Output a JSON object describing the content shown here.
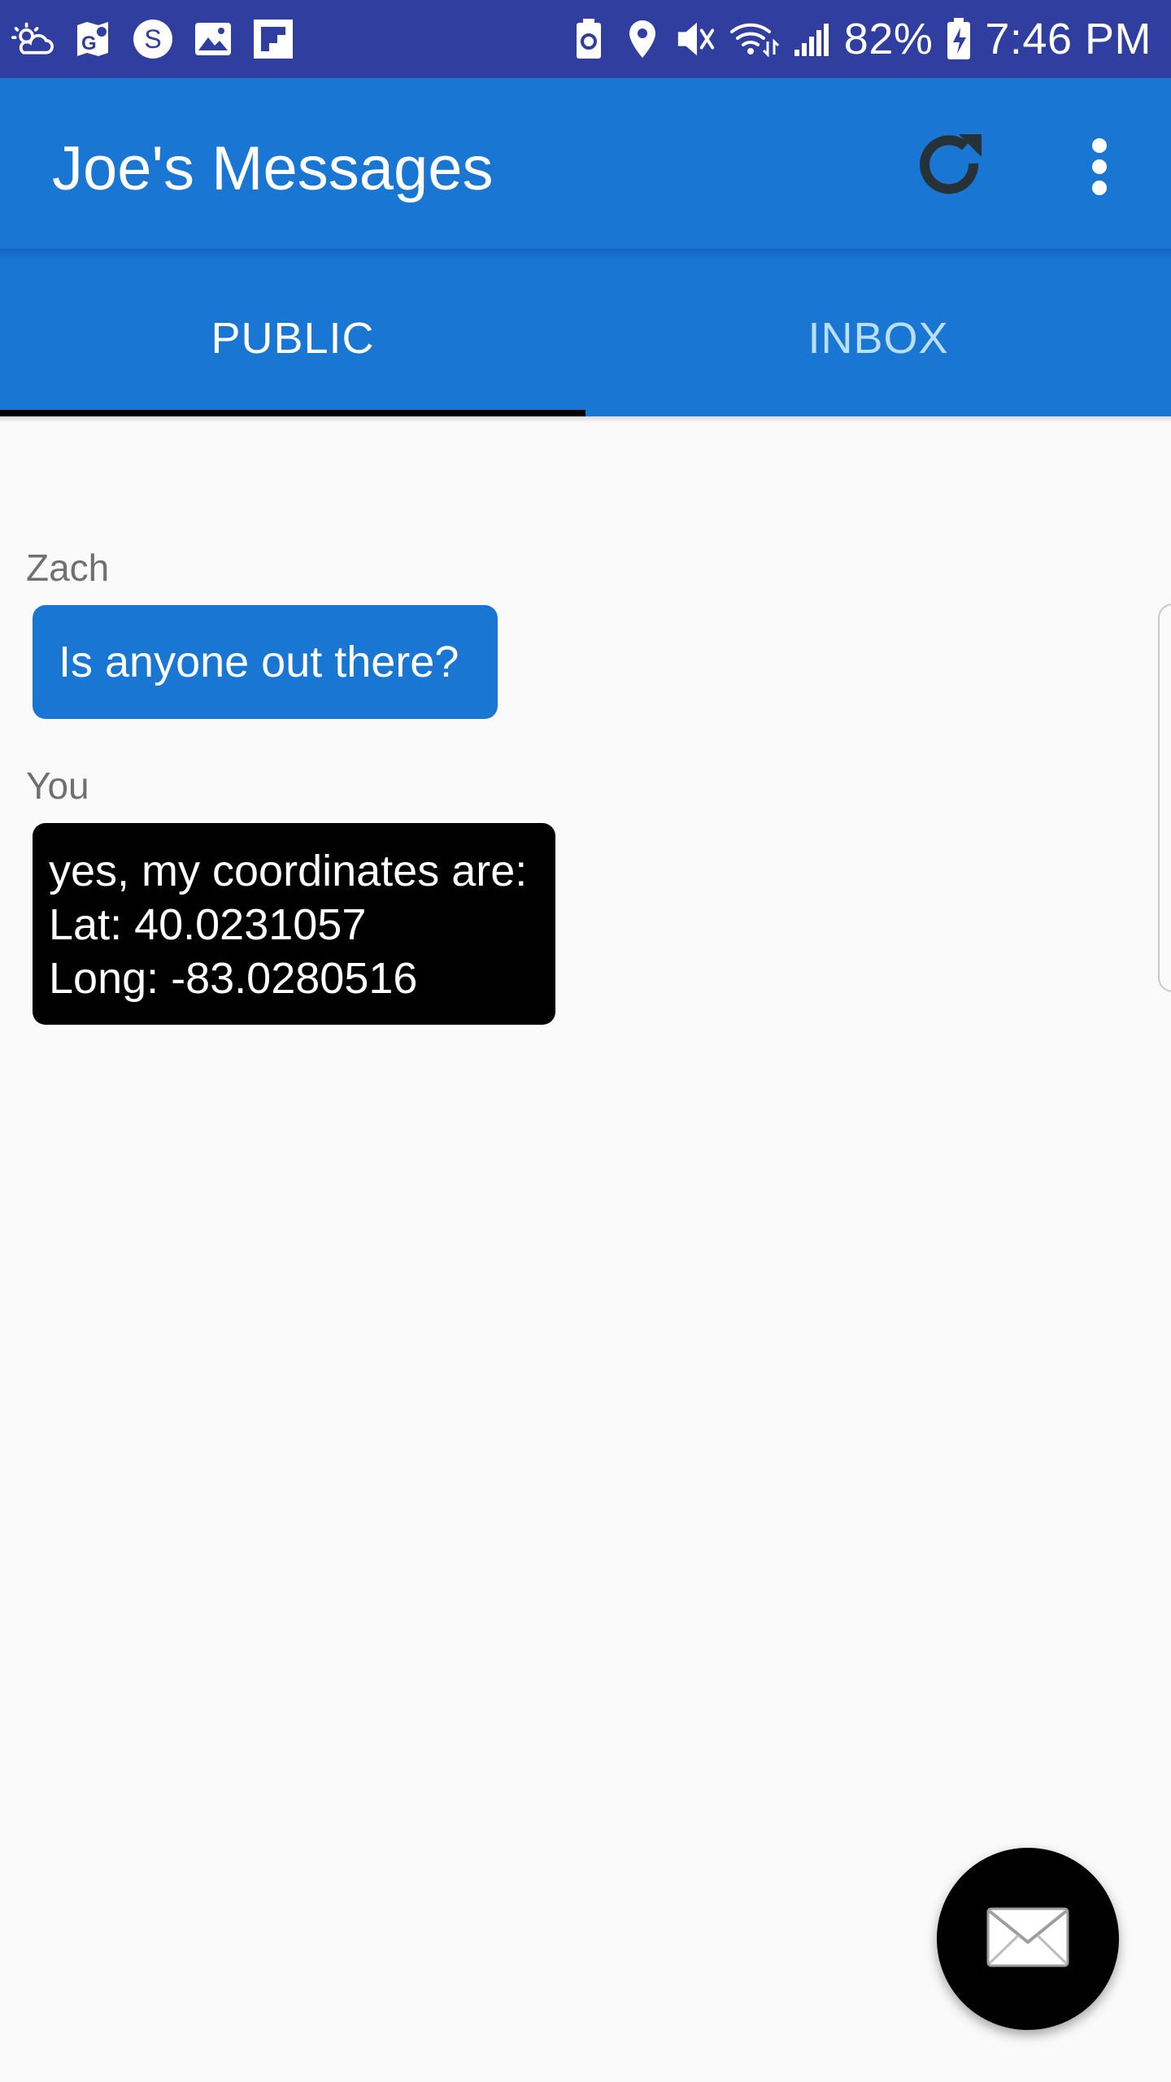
{
  "status_bar": {
    "icons_left": [
      "weather-icon",
      "maps-icon",
      "s-app-icon",
      "gallery-icon",
      "flipboard-icon"
    ],
    "icons_right": [
      "recycle-battery-icon",
      "location-icon",
      "mute-icon",
      "wifi-icon",
      "signal-icon"
    ],
    "battery_percent": "82%",
    "time": "7:46 PM",
    "colors": {
      "background": "#303f9f",
      "foreground": "#ffffff"
    }
  },
  "app_bar": {
    "title": "Joe's Messages",
    "refresh_icon": "refresh-icon",
    "overflow_icon": "overflow-menu-icon",
    "color": "#1976d2"
  },
  "tabs": [
    {
      "label": "PUBLIC",
      "active": true
    },
    {
      "label": "INBOX",
      "active": false
    }
  ],
  "messages": [
    {
      "sender": "Zach",
      "lines": [
        "Is anyone out there?"
      ],
      "bubble_color": "#1976d2"
    },
    {
      "sender": "You",
      "lines": [
        "yes, my coordinates are:",
        "Lat: 40.0231057",
        "Long: -83.0280516"
      ],
      "bubble_color": "#000000"
    }
  ],
  "fab": {
    "icon": "envelope-icon",
    "color": "#000000"
  }
}
